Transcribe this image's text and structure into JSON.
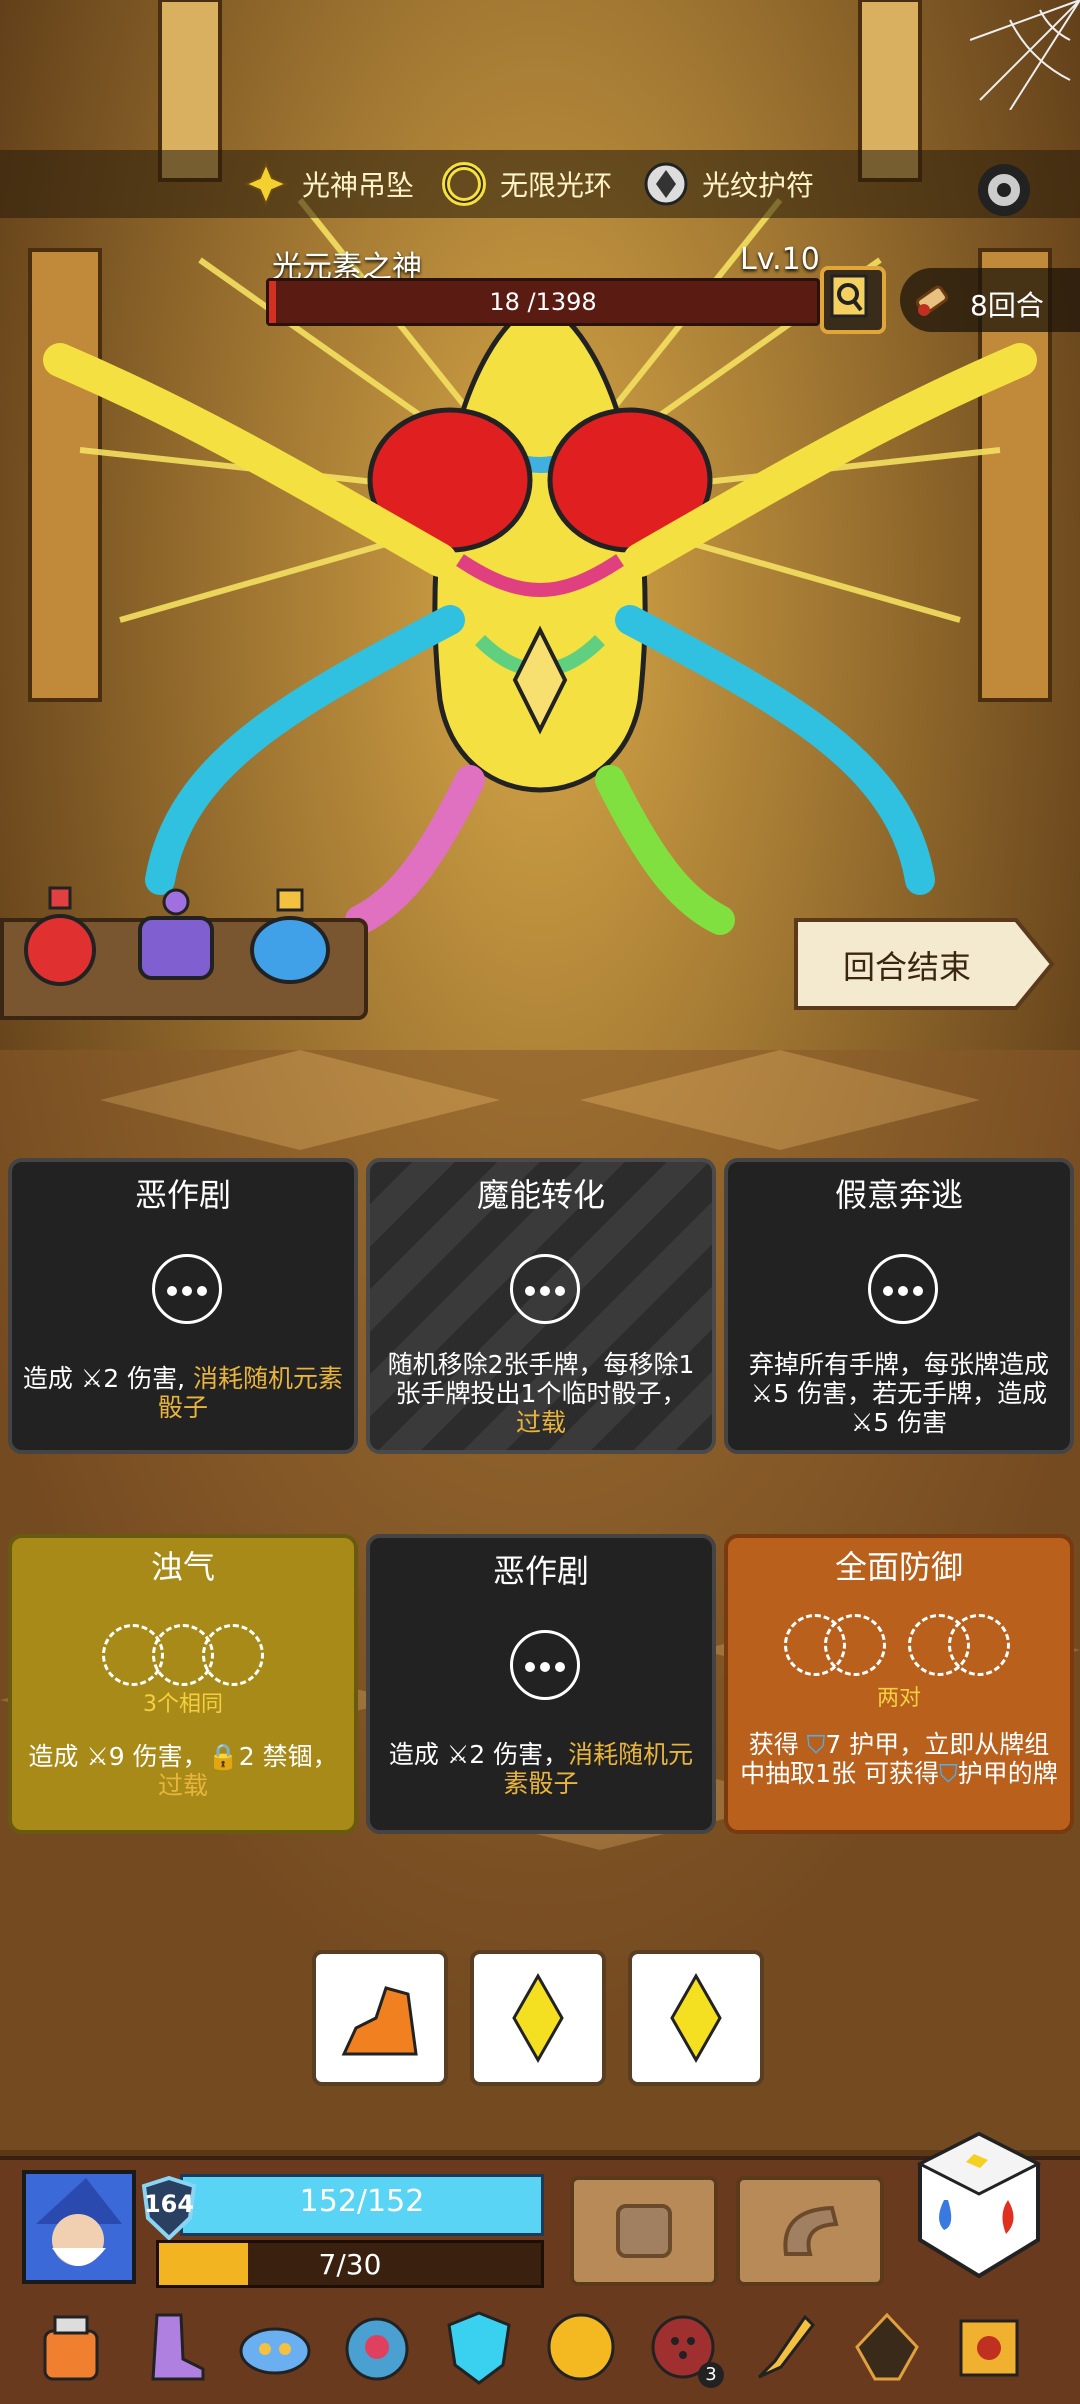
{
  "relics": [
    {
      "name": "光神吊坠",
      "icon": "star-pendant-icon"
    },
    {
      "name": "无限光环",
      "icon": "halo-ring-icon"
    },
    {
      "name": "光纹护符",
      "icon": "amulet-icon"
    }
  ],
  "boss": {
    "name": "光元素之神",
    "level": "Lv.10",
    "hp_text": "18 /1398",
    "hp_fraction": 0.013
  },
  "round": {
    "text": "8回合"
  },
  "end_turn": {
    "label": "回合结束"
  },
  "cards": [
    {
      "title": "恶作剧",
      "desc_a": "造成 ",
      "icon": "sword-icon",
      "desc_b": "2 伤害, ",
      "highlight": "消耗随机元素骰子",
      "style": "dark"
    },
    {
      "title": "魔能转化",
      "desc": "随机移除2张手牌，每移除1张手牌投出1个临时骰子，",
      "highlight": "过载",
      "style": "striped"
    },
    {
      "title": "假意奔逃",
      "desc_a": "弃掉所有手牌，每张牌造成",
      "desc_b": "5 伤害，若无手牌，造成",
      "desc_c": "5 伤害",
      "style": "dark"
    },
    {
      "title": "浊气",
      "requirement": "3个相同",
      "desc_a": "造成 ",
      "desc_b": "9 伤害，",
      "desc_c": "2 禁锢，",
      "highlight": "过载",
      "style": "yellow"
    },
    {
      "title": "恶作剧",
      "desc_a": "造成 ",
      "desc_b": "2 伤害，",
      "highlight": "消耗随机元素骰子",
      "style": "dark"
    },
    {
      "title": "全面防御",
      "requirement": "两对",
      "desc_a": "获得 ",
      "desc_b": "7 护甲，立即从牌组中抽取1张 可获得",
      "desc_c": "护甲的牌",
      "style": "orange"
    }
  ],
  "dice": [
    {
      "face": "fire-shape-icon",
      "color": "#f08020"
    },
    {
      "face": "diamond-icon",
      "color": "#f4e020"
    },
    {
      "face": "diamond-icon",
      "color": "#f4e020"
    }
  ],
  "player": {
    "armor": "164",
    "hp_text": "152/152",
    "hp_fraction": 1.0,
    "energy_text": "7/30",
    "energy_fraction": 0.233
  },
  "inventory": [
    {
      "icon": "potion-jar-icon"
    },
    {
      "icon": "boot-icon"
    },
    {
      "icon": "cloud-icon"
    },
    {
      "icon": "creature-icon"
    },
    {
      "icon": "gem-shield-icon"
    },
    {
      "icon": "golden-orb-icon"
    },
    {
      "icon": "button-icon",
      "badge": "3"
    },
    {
      "icon": "torch-icon"
    },
    {
      "icon": "dark-beast-icon"
    },
    {
      "icon": "spellbook-icon"
    }
  ],
  "colors": {
    "card_highlight": "#e8b43c",
    "hp_bar": "#d23020",
    "player_hp": "#5ad4f4",
    "energy": "#f2b420"
  }
}
